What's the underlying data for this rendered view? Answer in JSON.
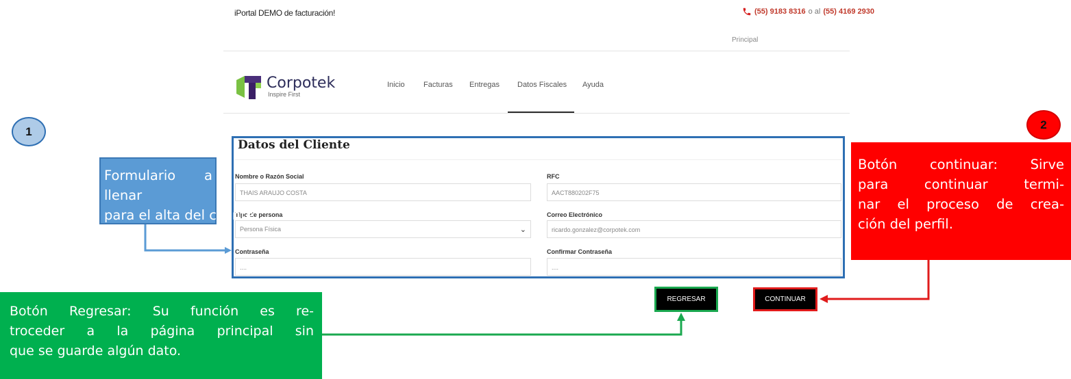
{
  "header": {
    "tagline": "iPortal DEMO de facturación!",
    "phone_1": "(55) 9183 8316",
    "phone_sep": "o al",
    "phone_2": "(55) 4169 2930",
    "top_link": "Principal"
  },
  "logo": {
    "name": "Corpotek",
    "slogan": "Inspire First"
  },
  "nav": {
    "items": [
      {
        "label": "Inicio"
      },
      {
        "label": "Facturas"
      },
      {
        "label": "Entregas"
      },
      {
        "label": "Datos Fiscales",
        "active": true
      },
      {
        "label": "Ayuda"
      }
    ]
  },
  "form": {
    "title": "Datos del Cliente",
    "fields": {
      "nombre": {
        "label": "Nombre o Razón Social",
        "value": "THAIS ARAUJO COSTA"
      },
      "rfc": {
        "label": "RFC",
        "value": "AACT880202F75"
      },
      "tipo": {
        "label": "Tipo de persona",
        "value": "Persona Física"
      },
      "correo": {
        "label": "Correo Electrónico",
        "value": "ricardo.gonzalez@corpotek.com"
      },
      "contrasena": {
        "label": "Contraseña",
        "value": "...."
      },
      "confirmar": {
        "label": "Confirmar Contraseña",
        "value": "...."
      }
    }
  },
  "buttons": {
    "regresar": "REGRESAR",
    "continuar": "CONTINUAR"
  },
  "annotations": {
    "badge_1": "1",
    "badge_2": "2",
    "callout_1": [
      "Formulario a llenar",
      "para el alta del cliente."
    ],
    "callout_2": [
      "Botón continuar: Sirve",
      "para continuar termi-",
      "nar el proceso de crea-",
      "ción del perfil."
    ],
    "callout_3": [
      "Botón Regresar: Su función es re-",
      "troceder a la página principal sin",
      "que se guarde algún dato."
    ]
  },
  "colors": {
    "form_border": "#2e6fb3",
    "callout_blue": "#5b9bd5",
    "callout_red": "#ff0000",
    "callout_green": "#00b04f",
    "phone_red": "#c0392b"
  }
}
